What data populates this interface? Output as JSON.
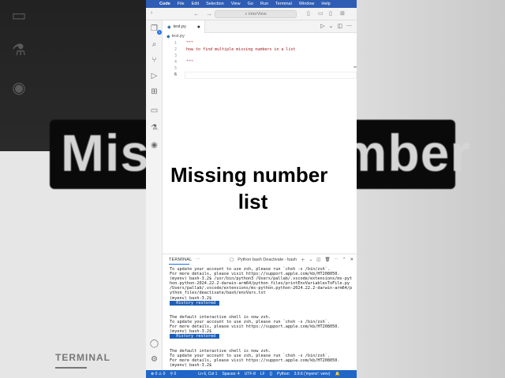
{
  "background": {
    "big_title": "Missing number",
    "terminal_label": "TERMINAL"
  },
  "menubar": {
    "items": [
      "Code",
      "File",
      "Edit",
      "Selection",
      "View",
      "Go",
      "Run",
      "Terminal",
      "Window",
      "Help"
    ]
  },
  "titlebar": {
    "search_placeholder": "interView"
  },
  "activity_bar": {
    "badge": "1",
    "icons": [
      "files-icon",
      "search-icon",
      "source-control-icon",
      "run-debug-icon",
      "extensions-icon",
      "remote-icon",
      "testing-icon",
      "docker-icon"
    ],
    "bottom_icons": [
      "account-icon",
      "settings-gear-icon"
    ]
  },
  "tab": {
    "filename": "test.py",
    "modified_marker": "●"
  },
  "breadcrumb": {
    "file": "test.py"
  },
  "editor": {
    "lines": [
      {
        "num": "1",
        "text": "\"\"\""
      },
      {
        "num": "2",
        "text": "how to find multiple missing numbers in a list"
      },
      {
        "num": "3",
        "text": ""
      },
      {
        "num": "4",
        "text": "\"\"\""
      },
      {
        "num": "5",
        "text": ""
      },
      {
        "num": "6",
        "text": ""
      }
    ],
    "current_line": "6"
  },
  "panel": {
    "tab": "TERMINAL",
    "more": "···",
    "terminal_instance": "Python bash Deactivate - bash",
    "lines": [
      {
        "text": "To update your account to use zsh, please run `chsh -s /bin/zsh`.",
        "hl": ""
      },
      {
        "text": "For more details, please visit https://support.apple.com/kb/HT208050.",
        "hl": ""
      },
      {
        "text": "(myenv) bash-3.2$ /usr/bin/python3 /Users/pallab/.vscode/extensions/ms-pyt",
        "hl": ""
      },
      {
        "text": "hon.python-2024.22.2-darwin-arm64/python_files/printEnvVariablesToFile.py",
        "hl": ""
      },
      {
        "text": "/Users/pallab/.vscode/extensions/ms-python.python-2024.22.2-darwin-arm64/p",
        "hl": ""
      },
      {
        "text": "ython_files/deactivate/bash/envVars.txt",
        "hl": ""
      },
      {
        "text": "(myenv) bash-3.2$",
        "hl": ""
      },
      {
        "text": "",
        "hl": "  History restored "
      },
      {
        "text": "",
        "hl": ""
      },
      {
        "text": "",
        "hl": ""
      },
      {
        "text": "The default interactive shell is now zsh.",
        "hl": ""
      },
      {
        "text": "To update your account to use zsh, please run `chsh -s /bin/zsh`.",
        "hl": ""
      },
      {
        "text": "For more details, please visit https://support.apple.com/kb/HT208050.",
        "hl": ""
      },
      {
        "text": "(myenv) bash-3.2$",
        "hl": ""
      },
      {
        "text": "",
        "hl": "  History restored "
      },
      {
        "text": "",
        "hl": ""
      },
      {
        "text": "",
        "hl": ""
      },
      {
        "text": "The default interactive shell is now zsh.",
        "hl": ""
      },
      {
        "text": "To update your account to use zsh, please run `chsh -s /bin/zsh`.",
        "hl": ""
      },
      {
        "text": "For more details, please visit https://support.apple.com/kb/HT208050.",
        "hl": ""
      },
      {
        "text": "(myenv) bash-3.2$",
        "hl": ""
      }
    ]
  },
  "statusbar": {
    "problems": "⊗ 0 ⚠ 0",
    "ports": "0",
    "cursor": "Ln 6, Col 1",
    "spaces": "Spaces: 4",
    "encoding": "UTF-8",
    "eol": "LF",
    "braces": "{}",
    "language": "Python",
    "interpreter": "3.9.6 ('myenv': venv)"
  },
  "caption": {
    "line1": "Missing number",
    "line2": "list"
  }
}
